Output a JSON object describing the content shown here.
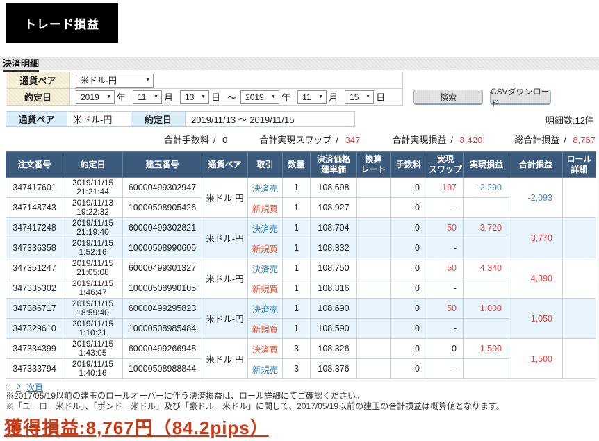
{
  "page": {
    "title_box": "トレード損益",
    "section_title": "決済明細"
  },
  "filters": {
    "currency_label": "通貨ペア",
    "currency_value": "米ドル-円",
    "date_label": "約定日",
    "from": {
      "year": "2019",
      "month": "11",
      "day": "13"
    },
    "to": {
      "year": "2019",
      "month": "11",
      "day": "15"
    },
    "suffix_year": "年",
    "suffix_month": "月",
    "suffix_day": "日",
    "range_separator": "～",
    "search_button": "検索",
    "csv_button": "CSVダウンロード"
  },
  "summary": {
    "currency_label": "通貨ペア",
    "currency_value": "米ドル-円",
    "date_label": "約定日",
    "date_value": "2019/11/13 ～ 2019/11/15",
    "count_text": "明細数:12件"
  },
  "totals_separator": "/",
  "totals": [
    {
      "label": "合計手数料",
      "value": "0",
      "red": false
    },
    {
      "label": "合計実現スワップ",
      "value": "347",
      "red": true
    },
    {
      "label": "合計実現損益",
      "value": "8,420",
      "red": true
    },
    {
      "label": "総合計損益",
      "value": "8,767",
      "red": true
    }
  ],
  "table": {
    "headers": [
      "注文番号",
      "約定日",
      "建玉番号",
      "通貨ペア",
      "取引",
      "数量",
      "決済価格\n建単価",
      "換算\nレート",
      "手数料",
      "実現\nスワップ",
      "実現損益",
      "合計損益",
      "ロール\n詳細"
    ],
    "groups": [
      {
        "shade": false,
        "pair": "米ドル-円",
        "total": "-2,093",
        "total_class": "neg",
        "rows": [
          {
            "order": "347417601",
            "date": "2019/11/15",
            "time": "21:21:44",
            "position": "60000499302947",
            "trade": "決済売",
            "trade_class": "sell",
            "qty": "1",
            "price": "108.698",
            "rate": "",
            "fee": "0",
            "swap": "197",
            "swap_class": "pos",
            "pl": "-2,290",
            "pl_class": "neg"
          },
          {
            "order": "347148743",
            "date": "2019/11/13",
            "time": "19:22:32",
            "position": "10000508905426",
            "trade": "新規買",
            "trade_class": "buy",
            "qty": "1",
            "price": "108.927",
            "rate": "",
            "fee": "0",
            "swap": "-",
            "swap_class": "",
            "pl": "",
            "pl_class": ""
          }
        ]
      },
      {
        "shade": true,
        "pair": "米ドル-円",
        "total": "3,770",
        "total_class": "pos",
        "rows": [
          {
            "order": "347417248",
            "date": "2019/11/15",
            "time": "21:19:40",
            "position": "60000499302821",
            "trade": "決済売",
            "trade_class": "sell",
            "qty": "1",
            "price": "108.704",
            "rate": "",
            "fee": "0",
            "swap": "50",
            "swap_class": "pos",
            "pl": "3,720",
            "pl_class": "pos"
          },
          {
            "order": "347336358",
            "date": "2019/11/15",
            "time": "1:52:16",
            "position": "10000508990605",
            "trade": "新規買",
            "trade_class": "buy",
            "qty": "1",
            "price": "108.332",
            "rate": "",
            "fee": "0",
            "swap": "-",
            "swap_class": "",
            "pl": "",
            "pl_class": ""
          }
        ]
      },
      {
        "shade": false,
        "pair": "米ドル-円",
        "total": "4,390",
        "total_class": "pos",
        "rows": [
          {
            "order": "347351247",
            "date": "2019/11/15",
            "time": "21:05:08",
            "position": "60000499301327",
            "trade": "決済売",
            "trade_class": "sell",
            "qty": "1",
            "price": "108.750",
            "rate": "",
            "fee": "0",
            "swap": "50",
            "swap_class": "pos",
            "pl": "4,340",
            "pl_class": "pos"
          },
          {
            "order": "347335302",
            "date": "2019/11/15",
            "time": "1:46:47",
            "position": "10000508990105",
            "trade": "新規買",
            "trade_class": "buy",
            "qty": "1",
            "price": "108.316",
            "rate": "",
            "fee": "0",
            "swap": "-",
            "swap_class": "",
            "pl": "",
            "pl_class": ""
          }
        ]
      },
      {
        "shade": true,
        "pair": "米ドル-円",
        "total": "1,050",
        "total_class": "pos",
        "rows": [
          {
            "order": "347386717",
            "date": "2019/11/15",
            "time": "18:59:40",
            "position": "60000499295823",
            "trade": "決済売",
            "trade_class": "sell",
            "qty": "1",
            "price": "108.690",
            "rate": "",
            "fee": "0",
            "swap": "50",
            "swap_class": "pos",
            "pl": "1,000",
            "pl_class": "pos"
          },
          {
            "order": "347329610",
            "date": "2019/11/15",
            "time": "1:10:21",
            "position": "10000508985484",
            "trade": "新規買",
            "trade_class": "buy",
            "qty": "1",
            "price": "108.590",
            "rate": "",
            "fee": "0",
            "swap": "-",
            "swap_class": "",
            "pl": "",
            "pl_class": ""
          }
        ]
      },
      {
        "shade": false,
        "pair": "米ドル-円",
        "total": "1,500",
        "total_class": "pos",
        "rows": [
          {
            "order": "347334399",
            "date": "2019/11/15",
            "time": "1:43:05",
            "position": "60000499266948",
            "trade": "決済買",
            "trade_class": "buy",
            "qty": "3",
            "price": "108.326",
            "rate": "",
            "fee": "0",
            "swap": "0",
            "swap_class": "",
            "pl": "1,500",
            "pl_class": "pos"
          },
          {
            "order": "347333794",
            "date": "2019/11/15",
            "time": "1:40:16",
            "position": "10000508988844",
            "trade": "新規売",
            "trade_class": "sell",
            "qty": "3",
            "price": "108.376",
            "rate": "",
            "fee": "0",
            "swap": "-",
            "swap_class": "",
            "pl": "",
            "pl_class": ""
          }
        ]
      }
    ]
  },
  "pagination": {
    "page1": "1",
    "page2": "2",
    "next": "次頁"
  },
  "notes": [
    "※2017/05/19以前の建玉のロールオーバーに伴う決済損益は、ロール詳細にてご確認ください。",
    "※「ユーロー米ドル」、「ポンドー米ドル」及び「豪ドルー米ドル」に関して、2017/05/19以前の建玉の合計損益は概算値となります。",
    "獲得損益:8,767円（84.2pips）"
  ],
  "colors": {
    "table_header_bg": "#3b5a7c",
    "buy_text": "#e8502d",
    "sell_text": "#2a7ab9",
    "positive_value": "#ec3e3e",
    "negative_value": "#4a86c8",
    "result_text": "#cf3813",
    "shade_row_bg": "#e7f4fc",
    "summary_label_bg": "#d9edf9",
    "filter_label_bg": "#f5efd9"
  }
}
